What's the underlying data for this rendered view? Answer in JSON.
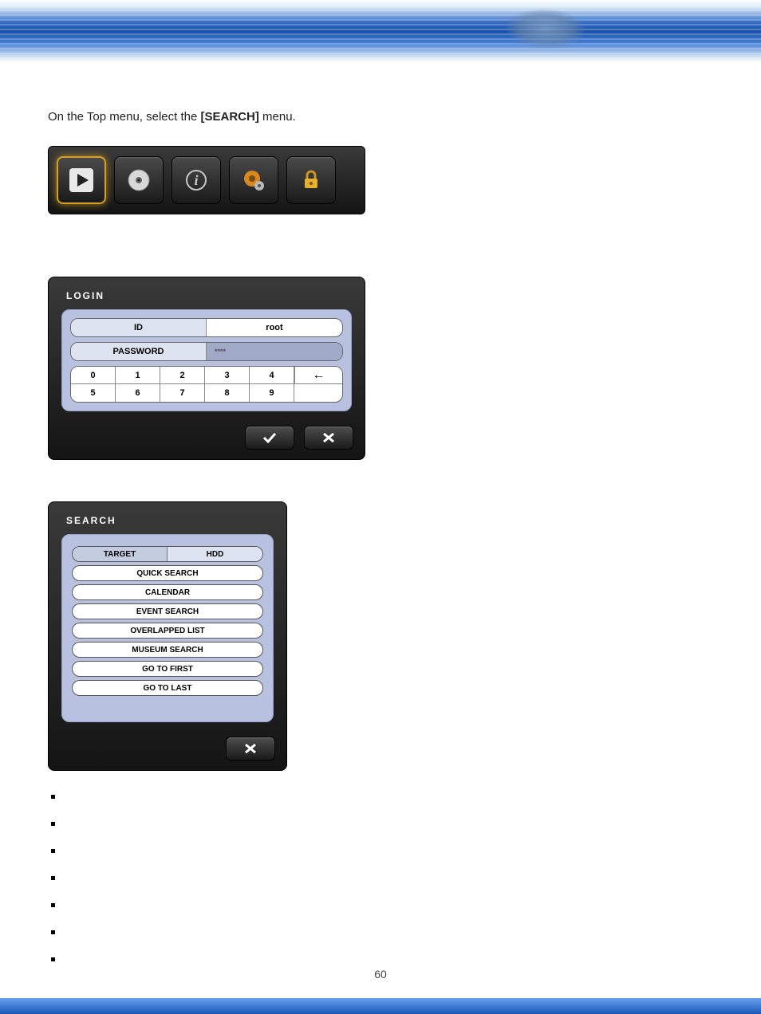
{
  "instruction": {
    "prefix": "On the Top menu, select the ",
    "bold": "[SEARCH]",
    "suffix": " menu."
  },
  "topmenu": {
    "items": [
      {
        "name": "search-icon",
        "selected": true
      },
      {
        "name": "disc-icon",
        "selected": false
      },
      {
        "name": "info-icon",
        "selected": false
      },
      {
        "name": "gear-icon",
        "selected": false
      },
      {
        "name": "lock-icon",
        "selected": false
      }
    ]
  },
  "login": {
    "title": "LOGIN",
    "id_label": "ID",
    "id_value": "root",
    "password_label": "PASSWORD",
    "password_value": "****",
    "keys_row1": [
      "0",
      "1",
      "2",
      "3",
      "4"
    ],
    "keys_row2": [
      "5",
      "6",
      "7",
      "8",
      "9"
    ],
    "backspace": "←"
  },
  "search": {
    "title": "SEARCH",
    "target_label": "TARGET",
    "target_value": "HDD",
    "items": [
      "QUICK SEARCH",
      "CALENDAR",
      "EVENT SEARCH",
      "OVERLAPPED LIST",
      "MUSEUM SEARCH",
      "GO TO FIRST",
      "GO TO LAST"
    ]
  },
  "bullets": [
    "",
    "",
    "",
    "",
    "",
    "",
    ""
  ],
  "page_number": "60"
}
